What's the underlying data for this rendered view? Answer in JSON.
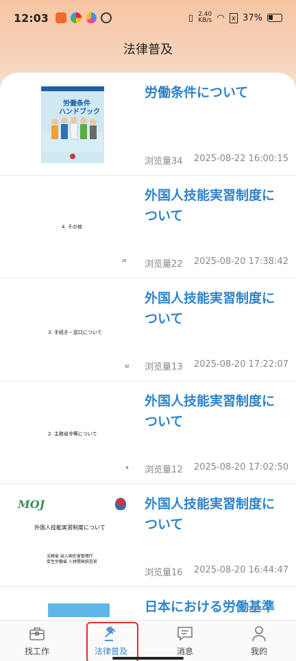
{
  "status_bar": {
    "time": "12:03",
    "net_speed_value": "2.40",
    "net_speed_unit": "KB/s",
    "battery": "37%"
  },
  "header": {
    "title": "法律普及"
  },
  "items": [
    {
      "title": "労働条件について",
      "views": "浏览量34",
      "date": "2025-08-22 16:00:15",
      "thumb_lines": [
        "労働条件",
        "ハンドブック"
      ]
    },
    {
      "title": "外国人技能実習制度について",
      "views": "浏览量22",
      "date": "2025-08-20 17:38:42",
      "thumb_lines": [
        "4. その他",
        "25"
      ]
    },
    {
      "title": "外国人技能実習制度について",
      "views": "浏览量13",
      "date": "2025-08-20 17:22:07",
      "thumb_lines": [
        "3. 手続き・窓口について",
        "32"
      ]
    },
    {
      "title": "外国人技能実習制度について",
      "views": "浏览量12",
      "date": "2025-08-20 17:02:50",
      "thumb_lines": [
        "2. 主務省令等について",
        "8"
      ]
    },
    {
      "title": "外国人技能実習制度について",
      "views": "浏览量16",
      "date": "2025-08-20 16:44:47",
      "thumb_lines": [
        "外国人技能実習制度について",
        "法務省 出入国在留管理庁",
        "厚生労働省 人材開発統括官"
      ]
    },
    {
      "title": "日本における労働基準関係法令について",
      "views": "",
      "date": "",
      "thumb_lines": []
    }
  ],
  "tabbar": {
    "tabs": [
      {
        "label": "找工作",
        "icon": "briefcase-icon"
      },
      {
        "label": "法律普及",
        "icon": "gavel-icon"
      },
      {
        "label": "消息",
        "icon": "message-icon"
      },
      {
        "label": "我的",
        "icon": "person-icon"
      }
    ],
    "active_index": 1
  },
  "colors": {
    "accent": "#2f83c9",
    "header_gradient_top": "#f7c6a3",
    "meta_text": "#888888"
  }
}
